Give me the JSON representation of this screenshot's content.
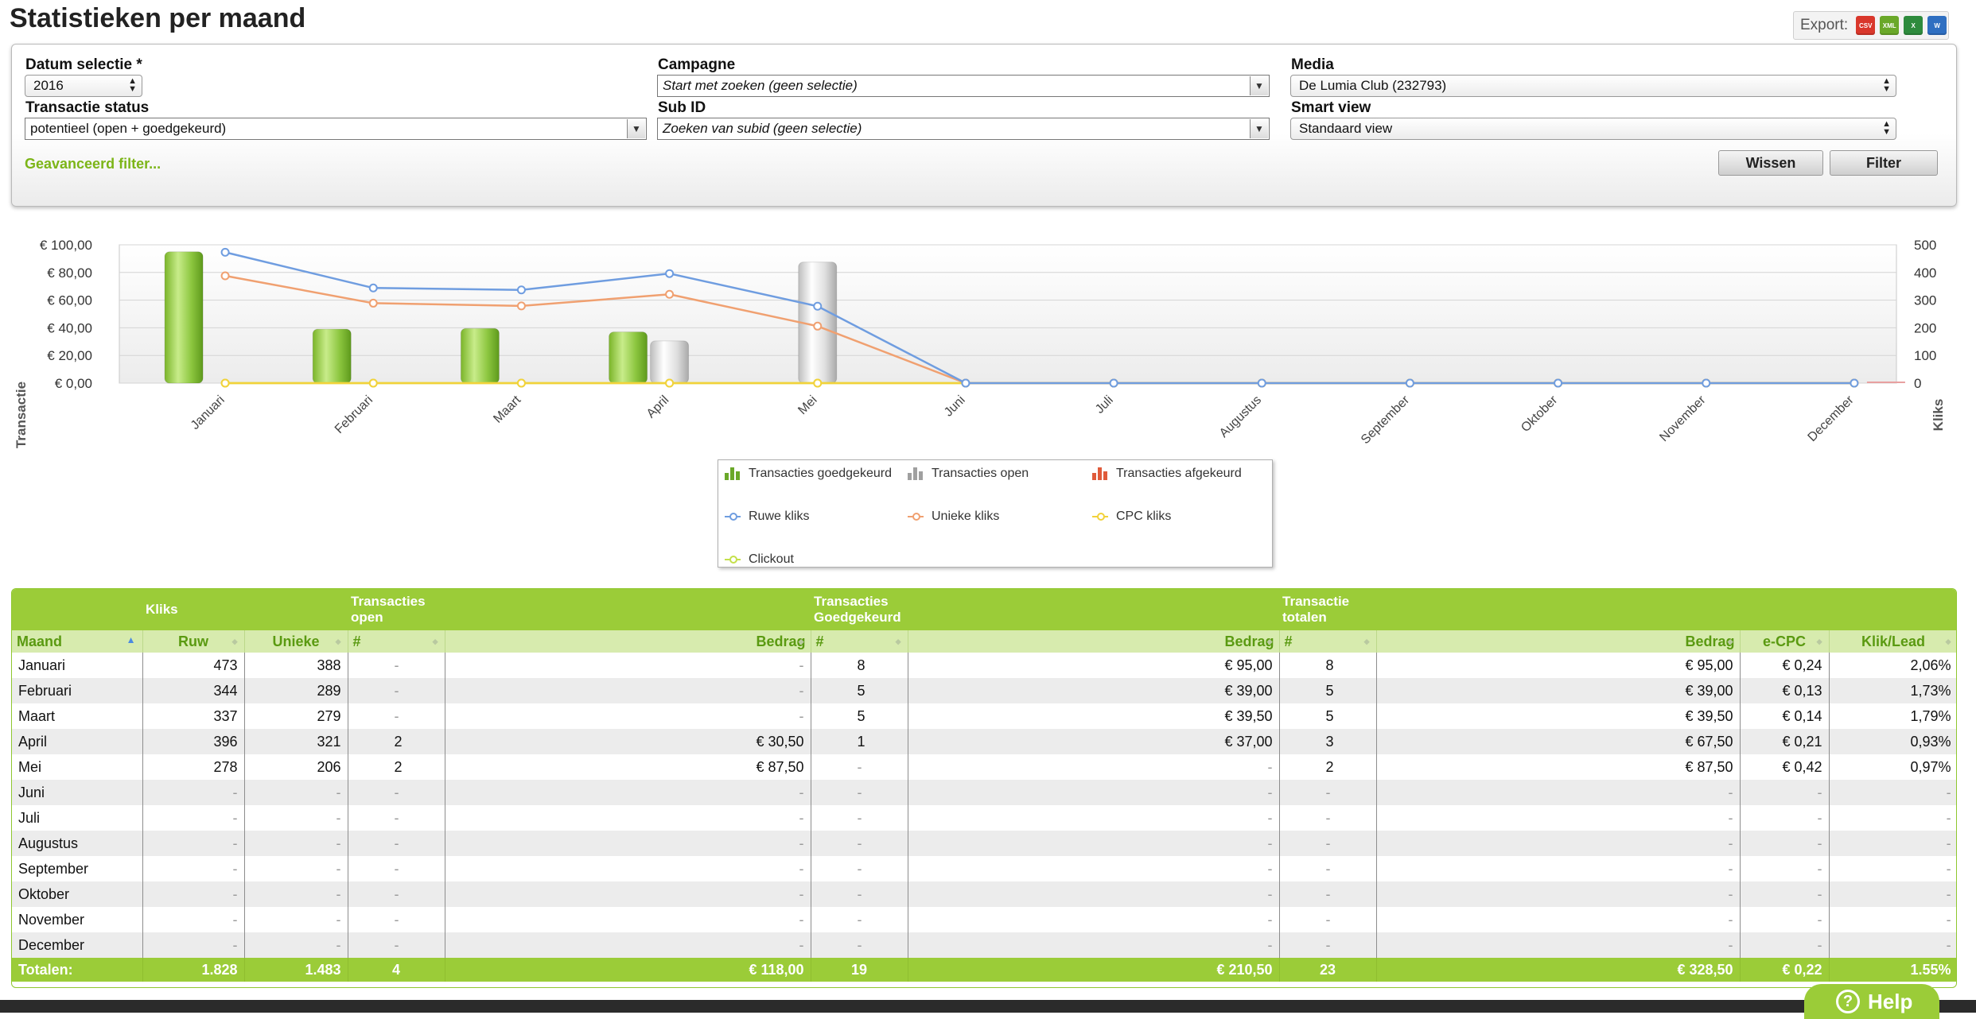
{
  "page": {
    "title": "Statistieken per maand"
  },
  "export": {
    "label": "Export:",
    "formats": [
      {
        "name": "csv-icon",
        "text": "CSV",
        "color": "#d9372b"
      },
      {
        "name": "xml-icon",
        "text": "XML",
        "color": "#6aa829"
      },
      {
        "name": "excel-icon",
        "text": "X",
        "color": "#2e8b3d"
      },
      {
        "name": "word-icon",
        "text": "W",
        "color": "#2f6fc1"
      }
    ]
  },
  "filters": {
    "datum_label": "Datum selectie *",
    "datum_value": "2016",
    "transactie_status_label": "Transactie status",
    "transactie_status_value": "potentieel (open + goedgekeurd)",
    "campagne_label": "Campagne",
    "campagne_value": "Start met zoeken (geen selectie)",
    "subid_label": "Sub ID",
    "subid_value": "Zoeken van subid (geen selectie)",
    "media_label": "Media",
    "media_value": "De Lumia Club (232793)",
    "smartview_label": "Smart view",
    "smartview_value": "Standaard view",
    "advanced_filter": "Geavanceerd filter...",
    "wissen": "Wissen",
    "filter": "Filter"
  },
  "chart_data": {
    "type": "bar",
    "categories": [
      "Januari",
      "Februari",
      "Maart",
      "April",
      "Mei",
      "Juni",
      "Juli",
      "Augustus",
      "September",
      "Oktober",
      "November",
      "December"
    ],
    "ylabel": "Transactie",
    "y2label": "Kliks",
    "left_ticks": [
      "€ 0,00",
      "€ 20,00",
      "€ 40,00",
      "€ 60,00",
      "€ 80,00",
      "€ 100,00"
    ],
    "right_ticks": [
      "0",
      "100",
      "200",
      "300",
      "400",
      "500"
    ],
    "ylim": [
      0,
      100
    ],
    "y2lim": [
      0,
      500
    ],
    "grid": true,
    "series": [
      {
        "name": "Transacties goedgekeurd",
        "kind": "bar",
        "axis": "left",
        "color": "#8cc63f",
        "values": [
          95,
          39,
          39.5,
          37,
          0,
          0,
          0,
          0,
          0,
          0,
          0,
          0
        ]
      },
      {
        "name": "Transacties open",
        "kind": "bar",
        "axis": "left",
        "color": "#d9d9d9",
        "values": [
          0,
          0,
          0,
          30.5,
          87.5,
          0,
          0,
          0,
          0,
          0,
          0,
          0
        ]
      },
      {
        "name": "Transacties afgekeurd",
        "kind": "bar",
        "axis": "left",
        "color": "#e05a3a",
        "values": [
          0,
          0,
          0,
          0,
          0,
          0,
          0,
          0,
          0,
          0,
          0,
          0
        ]
      },
      {
        "name": "Ruwe kliks",
        "kind": "line",
        "axis": "right",
        "color": "#6f9de0",
        "values": [
          473,
          344,
          337,
          396,
          278,
          0,
          0,
          0,
          0,
          0,
          0,
          0
        ]
      },
      {
        "name": "Unieke kliks",
        "kind": "line",
        "axis": "right",
        "color": "#f0a070",
        "values": [
          388,
          289,
          279,
          321,
          206,
          0,
          0,
          0,
          0,
          0,
          0,
          0
        ]
      },
      {
        "name": "CPC kliks",
        "kind": "line",
        "axis": "right",
        "color": "#f2d23a",
        "values": [
          0,
          0,
          0,
          0,
          0,
          0,
          0,
          0,
          0,
          0,
          0,
          0
        ]
      },
      {
        "name": "Clickout",
        "kind": "line",
        "axis": "right",
        "color": "#c4e04a",
        "values": [
          0,
          0,
          0,
          0,
          0,
          0,
          0,
          0,
          0,
          0,
          0,
          0
        ]
      }
    ]
  },
  "legend": {
    "items": [
      {
        "label": "Transacties goedgekeurd",
        "icon": "green-bar-icon",
        "color": "#6aa829"
      },
      {
        "label": "Transacties open",
        "icon": "gray-bar-icon",
        "color": "#a0a0a0"
      },
      {
        "label": "Transacties afgekeurd",
        "icon": "red-bar-icon",
        "color": "#e05a3a"
      },
      {
        "label": "Ruwe kliks",
        "icon": "blue-line-icon",
        "color": "#6f9de0"
      },
      {
        "label": "Unieke kliks",
        "icon": "orange-line-icon",
        "color": "#f0a070"
      },
      {
        "label": "CPC kliks",
        "icon": "yellow-line-icon",
        "color": "#f2d23a"
      },
      {
        "label": "Clickout",
        "icon": "lime-line-icon",
        "color": "#c4e04a"
      }
    ]
  },
  "table": {
    "groups": {
      "kliks": "Kliks",
      "open_1": "Transacties",
      "open_2": "open",
      "goed_1": "Transacties",
      "goed_2": "Goedgekeurd",
      "tot_1": "Transactie",
      "tot_2": "totalen"
    },
    "columns": [
      "Maand",
      "Ruw",
      "Unieke",
      "#",
      "Bedrag",
      "#",
      "Bedrag",
      "#",
      "Bedrag",
      "e-CPC",
      "Klik/Lead"
    ],
    "rows": [
      [
        "Januari",
        "473",
        "388",
        "-",
        "-",
        "8",
        "€ 95,00",
        "8",
        "€ 95,00",
        "€ 0,24",
        "2,06%"
      ],
      [
        "Februari",
        "344",
        "289",
        "-",
        "-",
        "5",
        "€ 39,00",
        "5",
        "€ 39,00",
        "€ 0,13",
        "1,73%"
      ],
      [
        "Maart",
        "337",
        "279",
        "-",
        "-",
        "5",
        "€ 39,50",
        "5",
        "€ 39,50",
        "€ 0,14",
        "1,79%"
      ],
      [
        "April",
        "396",
        "321",
        "2",
        "€ 30,50",
        "1",
        "€ 37,00",
        "3",
        "€ 67,50",
        "€ 0,21",
        "0,93%"
      ],
      [
        "Mei",
        "278",
        "206",
        "2",
        "€ 87,50",
        "-",
        "-",
        "2",
        "€ 87,50",
        "€ 0,42",
        "0,97%"
      ],
      [
        "Juni",
        "-",
        "-",
        "-",
        "-",
        "-",
        "-",
        "-",
        "-",
        "-",
        "-"
      ],
      [
        "Juli",
        "-",
        "-",
        "-",
        "-",
        "-",
        "-",
        "-",
        "-",
        "-",
        "-"
      ],
      [
        "Augustus",
        "-",
        "-",
        "-",
        "-",
        "-",
        "-",
        "-",
        "-",
        "-",
        "-"
      ],
      [
        "September",
        "-",
        "-",
        "-",
        "-",
        "-",
        "-",
        "-",
        "-",
        "-",
        "-"
      ],
      [
        "Oktober",
        "-",
        "-",
        "-",
        "-",
        "-",
        "-",
        "-",
        "-",
        "-",
        "-"
      ],
      [
        "November",
        "-",
        "-",
        "-",
        "-",
        "-",
        "-",
        "-",
        "-",
        "-",
        "-"
      ],
      [
        "December",
        "-",
        "-",
        "-",
        "-",
        "-",
        "-",
        "-",
        "-",
        "-",
        "-"
      ]
    ],
    "totals": [
      "Totalen:",
      "1.828",
      "1.483",
      "4",
      "€ 118,00",
      "19",
      "€ 210,50",
      "23",
      "€ 328,50",
      "€ 0,22",
      "1.55%"
    ]
  },
  "help": {
    "label": "Help"
  }
}
